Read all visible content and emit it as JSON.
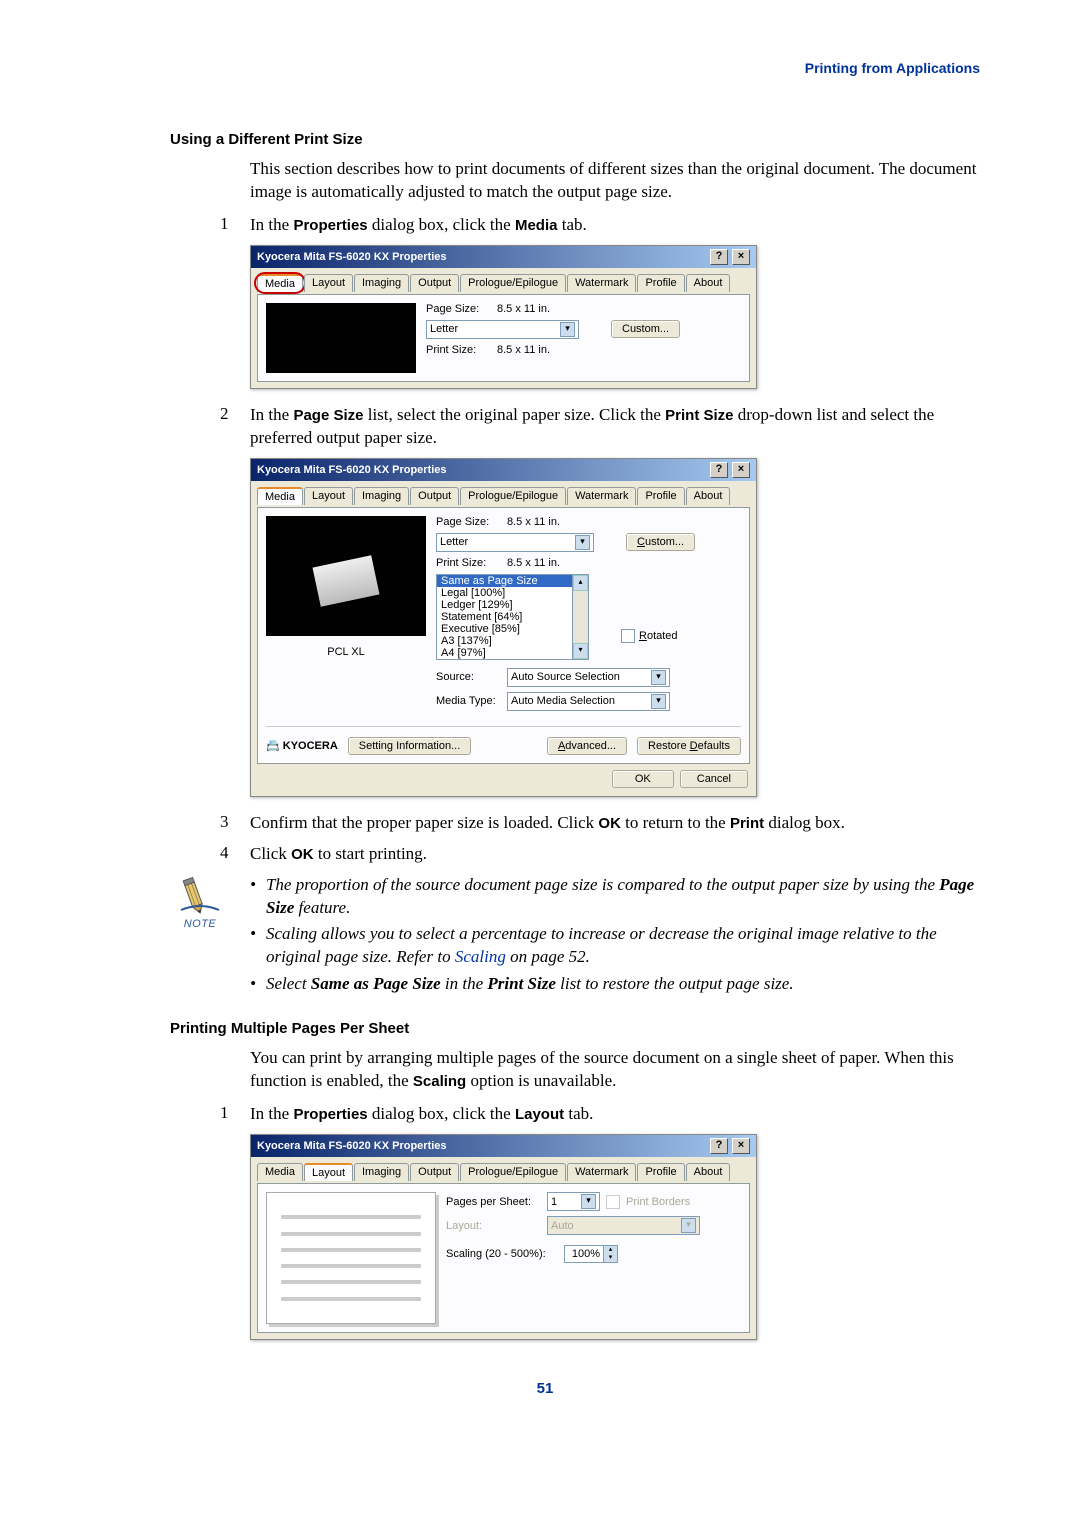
{
  "header": {
    "link_label": "Printing from Applications"
  },
  "section1": {
    "title": "Using a Different Print Size",
    "para": "This section describes how to print documents of different sizes than the original document. The document image is automatically adjusted to match the output page size.",
    "step1": {
      "num": "1",
      "text_pre": "In the ",
      "b1": "Properties",
      "mid": " dialog box, click the ",
      "b2": "Media",
      "post": " tab."
    },
    "step2": {
      "num": "2",
      "text_pre": "In the ",
      "b1": "Page Size",
      "mid": " list, select the original paper size. Click the ",
      "b2": "Print Size",
      "post": " drop-down list and select the preferred output paper size."
    },
    "step3": {
      "num": "3",
      "pre": "Confirm that the proper paper size is loaded. Click ",
      "b1": "OK",
      "mid": " to return to the ",
      "b2": "Print",
      "post": " dialog box."
    },
    "step4": {
      "num": "4",
      "pre": "Click ",
      "b1": "OK",
      "post": " to start printing."
    }
  },
  "notes": {
    "note_label": "NOTE",
    "n1": {
      "a": "The proportion of the source document page size is compared to the output paper size by using the ",
      "b": "Page Size",
      "c": " feature."
    },
    "n2": {
      "a": "Scaling allows you to select a percentage to increase or decrease the original image relative to the original page size. Refer to ",
      "link": "Scaling",
      "c": " on page 52."
    },
    "n3": {
      "a": "Select ",
      "b": "Same as Page Size",
      "c": " in the ",
      "d": "Print Size",
      "e": " list to restore the output page size."
    }
  },
  "section2": {
    "title": "Printing Multiple Pages Per Sheet",
    "para": {
      "a": "You can print by arranging multiple pages of the source document on a single sheet of paper. When this function is enabled, the ",
      "b": "Scaling",
      "c": " option is unavailable."
    },
    "step1": {
      "num": "1",
      "text_pre": "In the ",
      "b1": "Properties",
      "mid": " dialog box, click the ",
      "b2": "Layout",
      "post": " tab."
    }
  },
  "page_number": "51",
  "dlg_common": {
    "title_text": "Kyocera Mita FS-6020 KX Properties",
    "tabs": [
      "Media",
      "Layout",
      "Imaging",
      "Output",
      "Prologue/Epilogue",
      "Watermark",
      "Profile",
      "About"
    ],
    "page_size_label": "Page Size:",
    "print_size_label": "Print Size:",
    "dim": "8.5 x 11 in.",
    "letter": "Letter",
    "custom_btn": "Custom...",
    "source_label": "Source:",
    "mediatype_label": "Media Type:",
    "source_val": "Auto Source Selection",
    "mediatype_val": "Auto Media Selection",
    "rotated": "Rotated",
    "pclxl": "PCL XL",
    "kyocera": "KYOCERA",
    "setting_info": "Setting Information...",
    "advanced": "Advanced...",
    "restore": "Restore Defaults",
    "ok": "OK",
    "cancel": "Cancel",
    "size_list": [
      "Same as Page Size",
      "Legal [100%]",
      "Ledger [129%]",
      "Statement [64%]",
      "Executive [85%]",
      "A3 [137%]",
      "A4 [97%]"
    ],
    "size_list_selected": "Same as Page Size"
  },
  "dlg3": {
    "pages_per_sheet_label": "Pages per Sheet:",
    "pages_val": "1",
    "print_borders": "Print Borders",
    "layout_label": "Layout:",
    "layout_val": "Auto",
    "scaling_label": "Scaling (20 - 500%):",
    "scaling_val": "100%"
  }
}
